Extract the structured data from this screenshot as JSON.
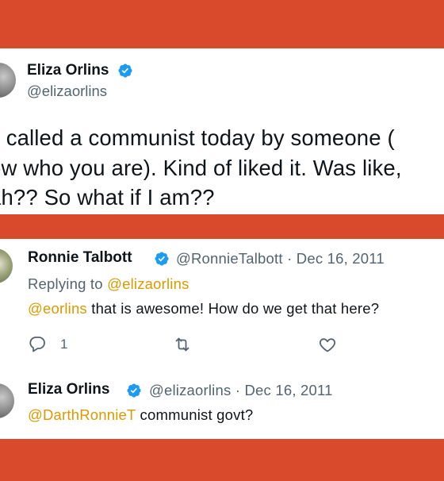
{
  "main_tweet": {
    "author_name": "Eliza Orlins",
    "author_handle": "@elizaorlins",
    "lines": [
      "s called a communist today by someone (",
      "ow who you are). Kind of liked it. Was like,",
      "ah?? So what if I am??"
    ]
  },
  "reply_1": {
    "author_name": "Ronnie Talbott",
    "author_handle": "@RonnieTalbott",
    "separator": "·",
    "date": "Dec 16, 2011",
    "replying_label": "Replying to",
    "replying_to": "@elizaorlins",
    "mention": "@eorlins",
    "text": " that is awesome! How do we get that here?",
    "reply_count": "1",
    "icons": [
      "reply-icon",
      "retweet-icon",
      "like-icon"
    ]
  },
  "reply_2": {
    "author_name": "Eliza Orlins",
    "author_handle": "@elizaorlins",
    "separator": "·",
    "date": "Dec 16, 2011",
    "mention": "@DarthRonnieT",
    "text": " communist govt?"
  },
  "colors": {
    "background": "#d84a2b",
    "verified": "#1d9bf0",
    "mention": "#d99a00",
    "secondary_text": "#536471"
  }
}
